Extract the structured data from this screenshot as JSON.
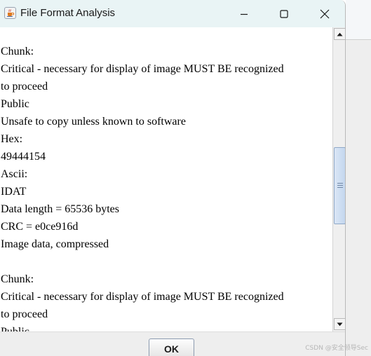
{
  "window": {
    "title": "File Format Analysis"
  },
  "content": {
    "lines": [
      "Chunk:",
      "Critical - necessary for display of image MUST BE recognized",
      "to proceed",
      "Public",
      "Unsafe to copy unless known to software",
      "Hex:",
      "49444154",
      "Ascii:",
      "IDAT",
      "Data length = 65536 bytes",
      "CRC = e0ce916d",
      "Image data, compressed",
      "",
      "Chunk:",
      "Critical - necessary for display of image MUST BE recognized",
      "to proceed",
      "Public"
    ]
  },
  "buttons": {
    "ok_label": "OK"
  },
  "watermark": "CSDN @安全领导Sec",
  "icons": {
    "minimize": "minimize-icon",
    "maximize": "maximize-icon",
    "close": "close-icon",
    "app": "java-coffee-icon"
  }
}
